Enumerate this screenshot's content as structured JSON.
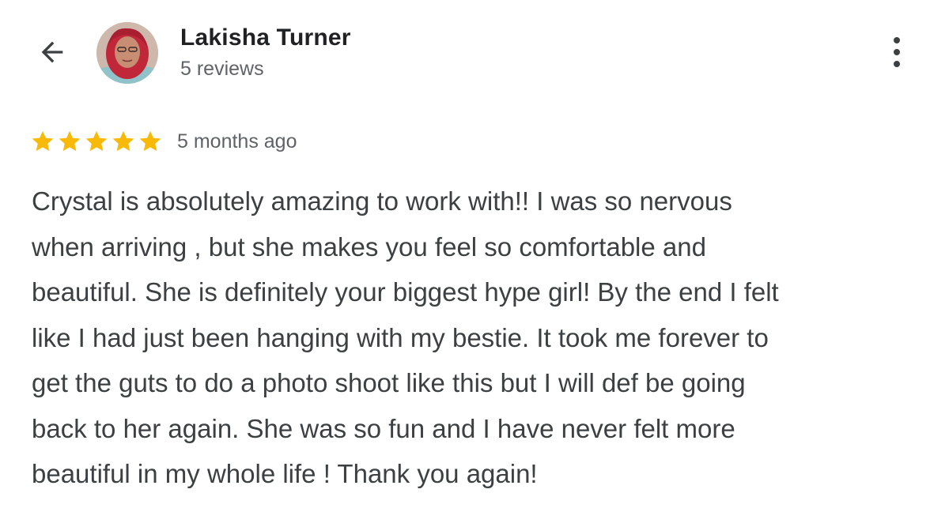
{
  "user": {
    "name": "Lakisha Turner",
    "review_count": "5 reviews"
  },
  "review": {
    "rating": 5,
    "max_rating": 5,
    "time_ago": "5 months ago",
    "lines": [
      "Crystal is absolutely amazing to work with!! I was so nervous",
      "when arriving , but she makes you feel so comfortable and",
      "beautiful. She is definitely your biggest hype girl! By the end I felt",
      "like I had just been hanging with my bestie. It took me forever to",
      "get the guts to do a photo shoot like this but I will def be going",
      "back to her again. She was so fun and I have never felt more",
      "beautiful in my whole life ! Thank you again!"
    ]
  },
  "icons": {
    "back": "arrow-back-icon",
    "more": "more-vert-icon",
    "star": "star-icon"
  },
  "colors": {
    "star": "#F9B908",
    "name": "#202124",
    "secondary": "#5f6368",
    "body": "#3c4043"
  }
}
